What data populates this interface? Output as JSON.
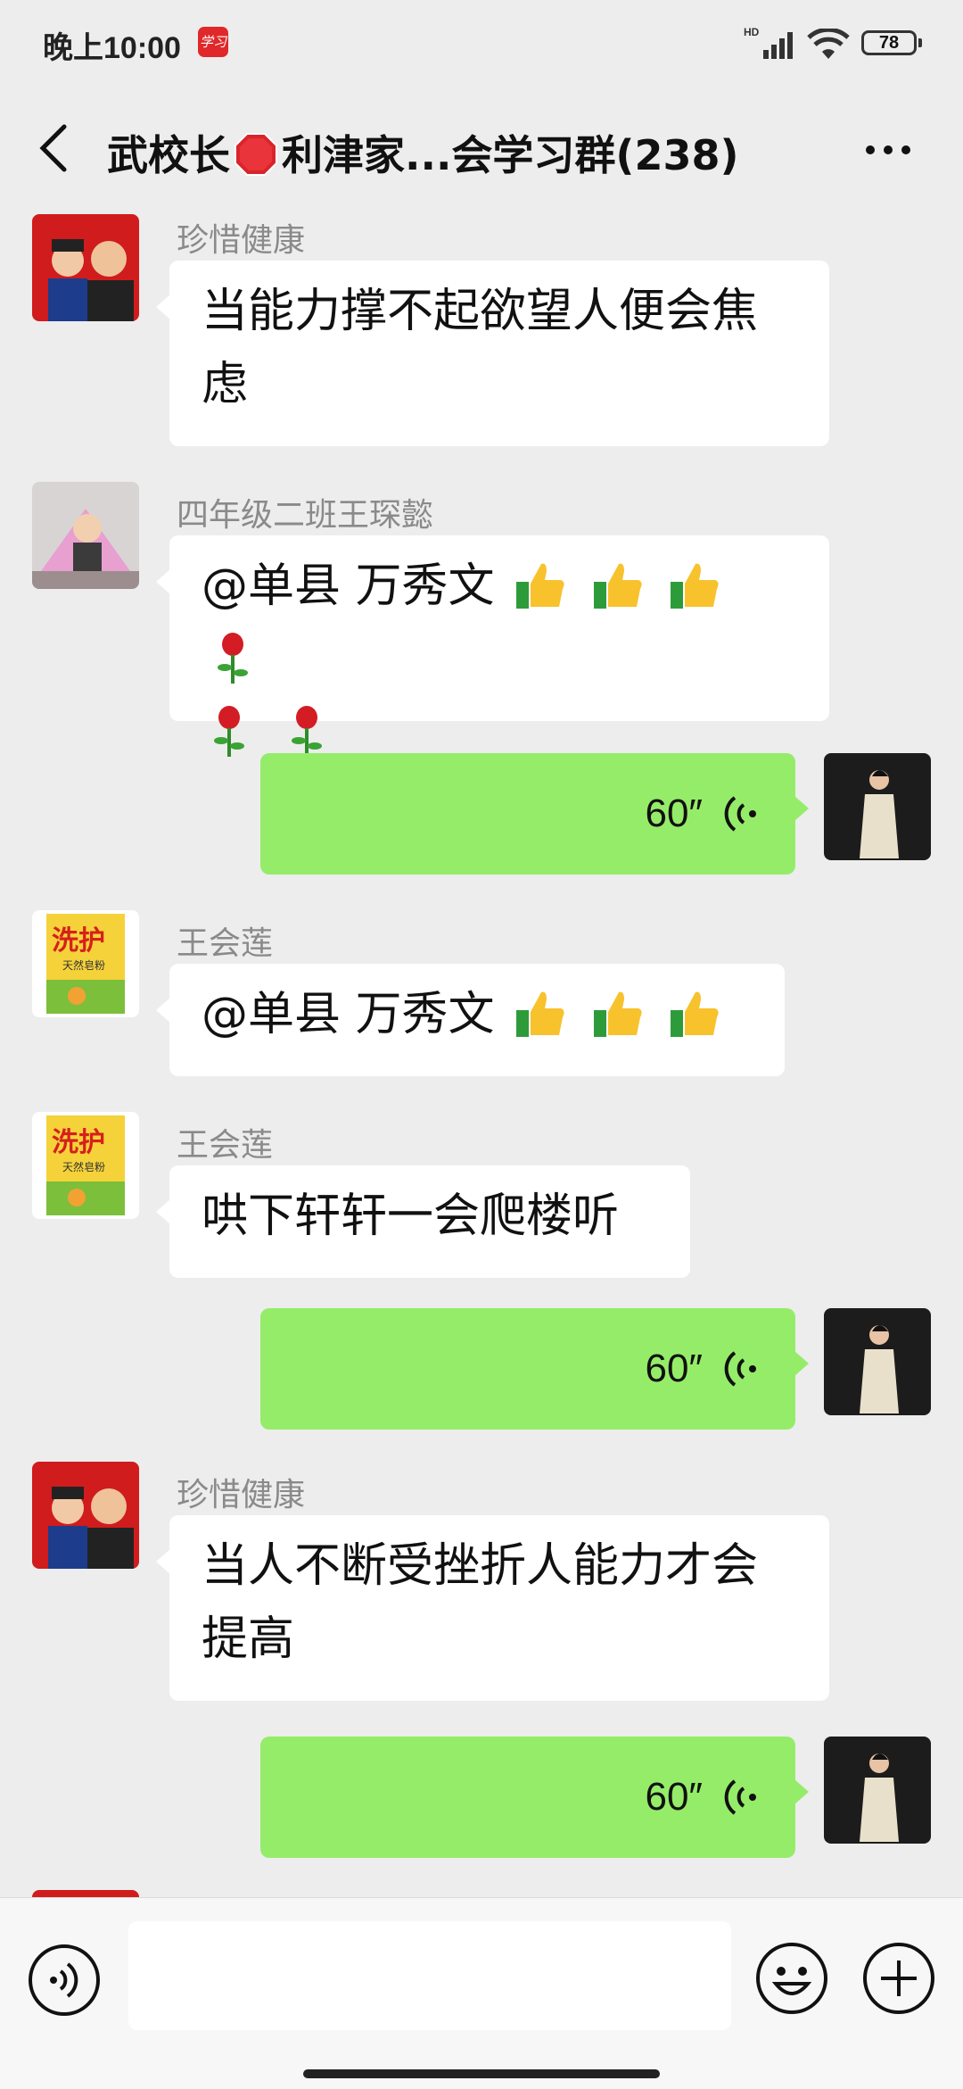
{
  "status_bar": {
    "time": "晚上10:00",
    "app_icon_text": "学习",
    "network": "HD",
    "battery": "78"
  },
  "header": {
    "title_part1": "武校长",
    "title_part2": "利津家...会学习群(238)",
    "icons": [
      "back-icon",
      "stop-sign-icon",
      "more-icon"
    ]
  },
  "messages": [
    {
      "type": "text",
      "side": "left",
      "sender": "珍惜健康",
      "lines": [
        "当能力撑不起欲望人便会焦",
        "虑"
      ],
      "avatar": "father-son-photo"
    },
    {
      "type": "text",
      "side": "left",
      "sender": "四年级二班王琛懿",
      "line1": "@单县  万秀文",
      "line2_emojis": [
        "rose",
        "rose"
      ],
      "line1_emojis": [
        "thumbs-up",
        "thumbs-up",
        "thumbs-up",
        "rose"
      ],
      "avatar": "child-photo"
    },
    {
      "type": "voice",
      "side": "right",
      "duration": "60″",
      "avatar": "woman-photo"
    },
    {
      "type": "text",
      "side": "left",
      "sender": "王会莲",
      "line1": "@单县  万秀文",
      "line1_emojis": [
        "thumbs-up",
        "thumbs-up",
        "thumbs-up"
      ],
      "avatar": "soap-package-photo"
    },
    {
      "type": "text",
      "side": "left",
      "sender": "王会莲",
      "lines": [
        "哄下轩轩一会爬楼听"
      ],
      "avatar": "soap-package-photo"
    },
    {
      "type": "voice",
      "side": "right",
      "duration": "60″",
      "avatar": "woman-photo"
    },
    {
      "type": "text",
      "side": "left",
      "sender": "珍惜健康",
      "lines": [
        "当人不断受挫折人能力才会",
        "提高"
      ],
      "avatar": "father-son-photo"
    },
    {
      "type": "voice",
      "side": "right",
      "duration": "60″",
      "avatar": "woman-photo"
    }
  ],
  "avatar_texts": {
    "soap_brand": "洗护",
    "soap_sub": "天然皂粉"
  },
  "input_bar": {
    "placeholder": "",
    "icons": [
      "voice-input-icon",
      "emoji-icon",
      "plus-icon"
    ]
  },
  "colors": {
    "background": "#ededed",
    "voice_bubble": "#95ec69",
    "text_bubble": "#ffffff"
  }
}
